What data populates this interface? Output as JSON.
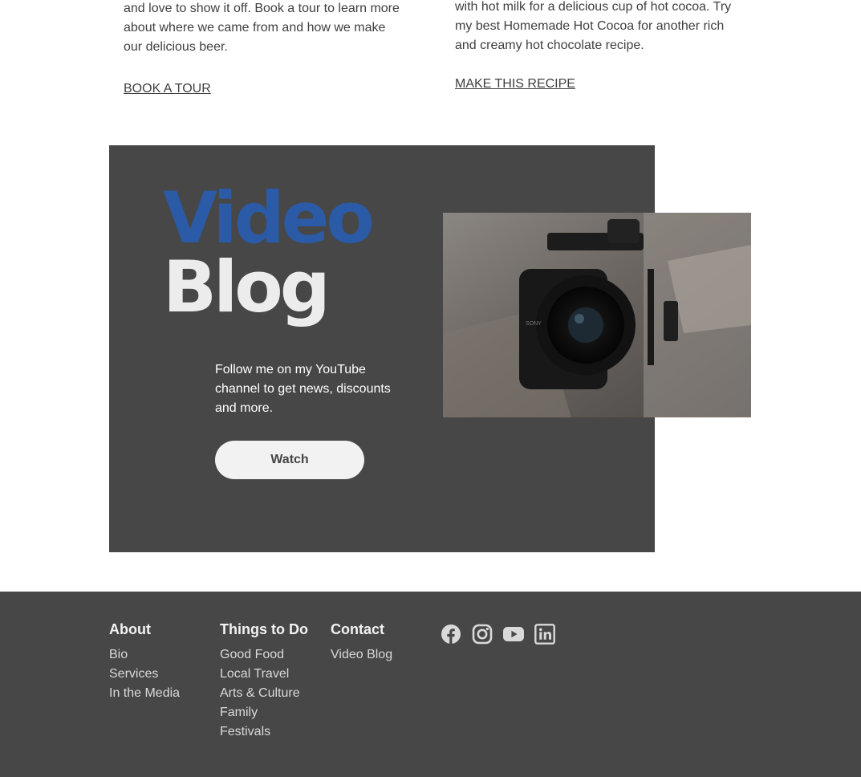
{
  "cards": {
    "tour": {
      "text": "and love to show it off. Book a tour to learn more about where we came from and how we make our delicious beer.",
      "link": "BOOK A TOUR"
    },
    "cocoa": {
      "text": "with hot milk for a delicious cup of hot cocoa. Try my best Homemade Hot Cocoa for another rich and creamy hot chocolate recipe.",
      "link": "MAKE THIS RECIPE"
    }
  },
  "video_blog": {
    "title_word1": "Video",
    "title_word2": "Blog",
    "description": "Follow me on my YouTube channel to get news, discounts and more.",
    "button_label": "Watch",
    "photo_icon": "camera-photo"
  },
  "footer": {
    "about": {
      "heading": "About",
      "links": [
        "Bio",
        "Services",
        "In the Media"
      ]
    },
    "things_to_do": {
      "heading": "Things to Do",
      "links": [
        "Good Food",
        "Local Travel",
        "Arts & Culture",
        "Family",
        "Festivals"
      ]
    },
    "contact": {
      "heading": "Contact",
      "links": [
        "Video Blog"
      ]
    },
    "social": [
      "facebook-icon",
      "instagram-icon",
      "youtube-icon",
      "linkedin-icon"
    ]
  },
  "colors": {
    "panel": "#474747",
    "accent_blue": "#2b5aa6",
    "footer_text": "#d9d9d9"
  }
}
